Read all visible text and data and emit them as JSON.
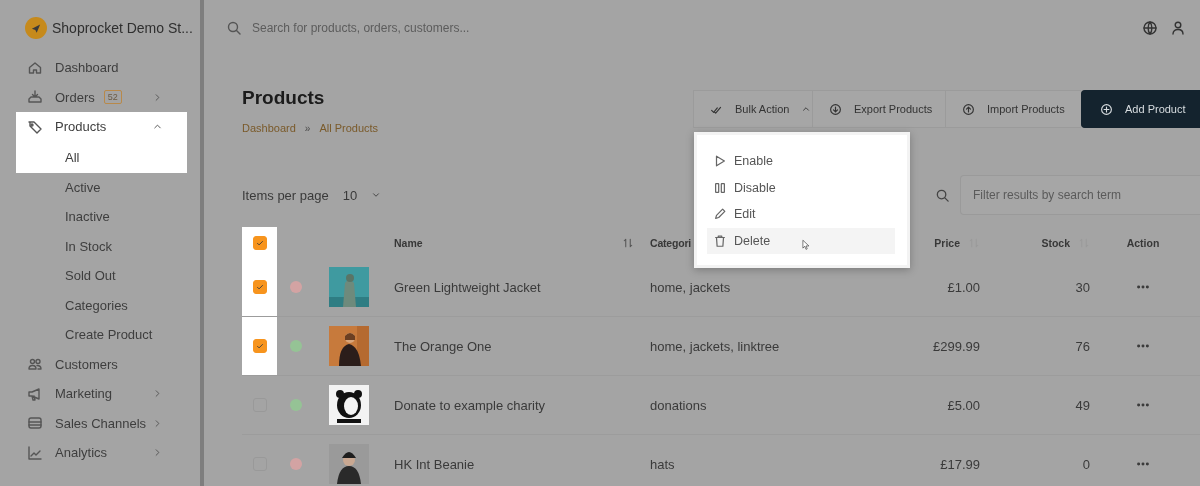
{
  "store": {
    "name": "Shoprocket Demo St..."
  },
  "sidebar": {
    "items": [
      {
        "label": "Dashboard",
        "selected": false
      },
      {
        "label": "Orders",
        "badge": "52",
        "selected": false,
        "expanded": false
      },
      {
        "label": "Products",
        "selected": true,
        "expanded": true,
        "children": [
          {
            "label": "All",
            "selected": true
          },
          {
            "label": "Active",
            "selected": false
          },
          {
            "label": "Inactive",
            "selected": false
          },
          {
            "label": "In Stock",
            "selected": false
          },
          {
            "label": "Sold Out",
            "selected": false
          },
          {
            "label": "Categories",
            "selected": false
          },
          {
            "label": "Create Product",
            "selected": false
          }
        ]
      },
      {
        "label": "Customers",
        "selected": false
      },
      {
        "label": "Marketing",
        "selected": false,
        "expanded": false
      },
      {
        "label": "Sales Channels",
        "selected": false,
        "expanded": false
      },
      {
        "label": "Analytics",
        "selected": false,
        "expanded": false
      }
    ]
  },
  "search": {
    "placeholder": "Search for products, orders, customers..."
  },
  "page": {
    "title": "Products",
    "breadcrumb": [
      "Dashboard",
      "All Products"
    ],
    "breadcrumb_separator": "»"
  },
  "toolbar": {
    "buttons": [
      {
        "label": "Bulk Action",
        "kind": "dropdown",
        "expanded": true
      },
      {
        "label": "Export Products",
        "kind": "export"
      },
      {
        "label": "Import Products",
        "kind": "import"
      },
      {
        "label": "Add Product",
        "kind": "primary"
      }
    ]
  },
  "bulk_menu": {
    "items": [
      {
        "label": "Enable",
        "hovered": false
      },
      {
        "label": "Disable",
        "hovered": false
      },
      {
        "label": "Edit",
        "hovered": false
      },
      {
        "label": "Delete",
        "hovered": true
      }
    ]
  },
  "pagination": {
    "label": "Items per page",
    "value": "10"
  },
  "filter": {
    "placeholder": "Filter results by search term"
  },
  "table": {
    "all_checked": true,
    "columns": [
      {
        "label": "Name",
        "sortable": true
      },
      {
        "label": "Categori",
        "sortable": false
      },
      {
        "label": "Price",
        "sortable": true
      },
      {
        "label": "Stock",
        "sortable": true
      },
      {
        "label": "Action",
        "sortable": false
      }
    ],
    "rows": [
      {
        "checked": true,
        "color": "#d3a3a3",
        "name": "Green Lightweight Jacket",
        "categories": "home, jackets",
        "price": "£1.00",
        "stock": "30"
      },
      {
        "checked": true,
        "color": "#95c395",
        "name": "The Orange One",
        "categories": "home, jackets, linktree",
        "price": "£299.99",
        "stock": "76"
      },
      {
        "checked": false,
        "color": "#95c395",
        "name": "Donate to example charity",
        "categories": "donations",
        "price": "£5.00",
        "stock": "49"
      },
      {
        "checked": false,
        "color": "#d3a3a3",
        "name": "HK Int Beanie",
        "categories": "hats",
        "price": "£17.99",
        "stock": "0"
      }
    ]
  }
}
